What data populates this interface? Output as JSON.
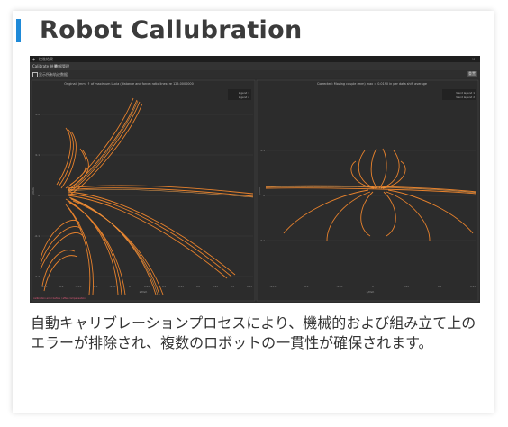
{
  "card": {
    "title": "Robot Callubration",
    "accent_color": "#1f8ad8",
    "caption": "自動キャリブレーションプロセスにより、機械的および組み立て上のエラーが排除され、複数のロボットの一貫性が確保されます。"
  },
  "app_window": {
    "title": "校准结果",
    "controls": [
      "–",
      "×"
    ],
    "toolbar": {
      "tabs": [
        "Calibrate 结果",
        "数据管理"
      ]
    },
    "options": {
      "checkbox_label": "显示所有轨迹数据",
      "button_label": "重置"
    },
    "plots": [
      {
        "title": "Original: (mm) ↑ of maximum Lucia (distance and force) ratio lines: re 125.0000000",
        "legend": [
          "legend 1",
          "legend 2"
        ],
        "ylabel": "y/mm",
        "xlabel": "x/mm",
        "yticks": [
          "0.2",
          "0.1",
          "0",
          "-0.1",
          "-0.2"
        ],
        "xticks": [
          "-0.25",
          "-0.2",
          "-0.15",
          "-0.1",
          "-0.05",
          "0",
          "0.05",
          "0.1",
          "0.15",
          "0.2",
          "0.25",
          "0.3",
          "0.35"
        ],
        "footer": "calibration error before / after compensation"
      },
      {
        "title": "Corrected: Moving couple (mm) max = 0.0190 in per data shift average",
        "legend": [
          "trend legend 1",
          "trend legend 2"
        ],
        "ylabel": "y/mm",
        "xlabel": "x/mm",
        "yticks": [
          "0.1",
          "0",
          "-0.1"
        ],
        "xticks": [
          "-0.15",
          "-0.1",
          "-0.05",
          "0",
          "0.05",
          "0.1",
          "0.15"
        ]
      }
    ],
    "colors": {
      "window_bg": "#2c2c2c",
      "curve": "#e8822c",
      "curve_highlight": "#f2a24e",
      "footer_text": "#e05a7a"
    }
  }
}
